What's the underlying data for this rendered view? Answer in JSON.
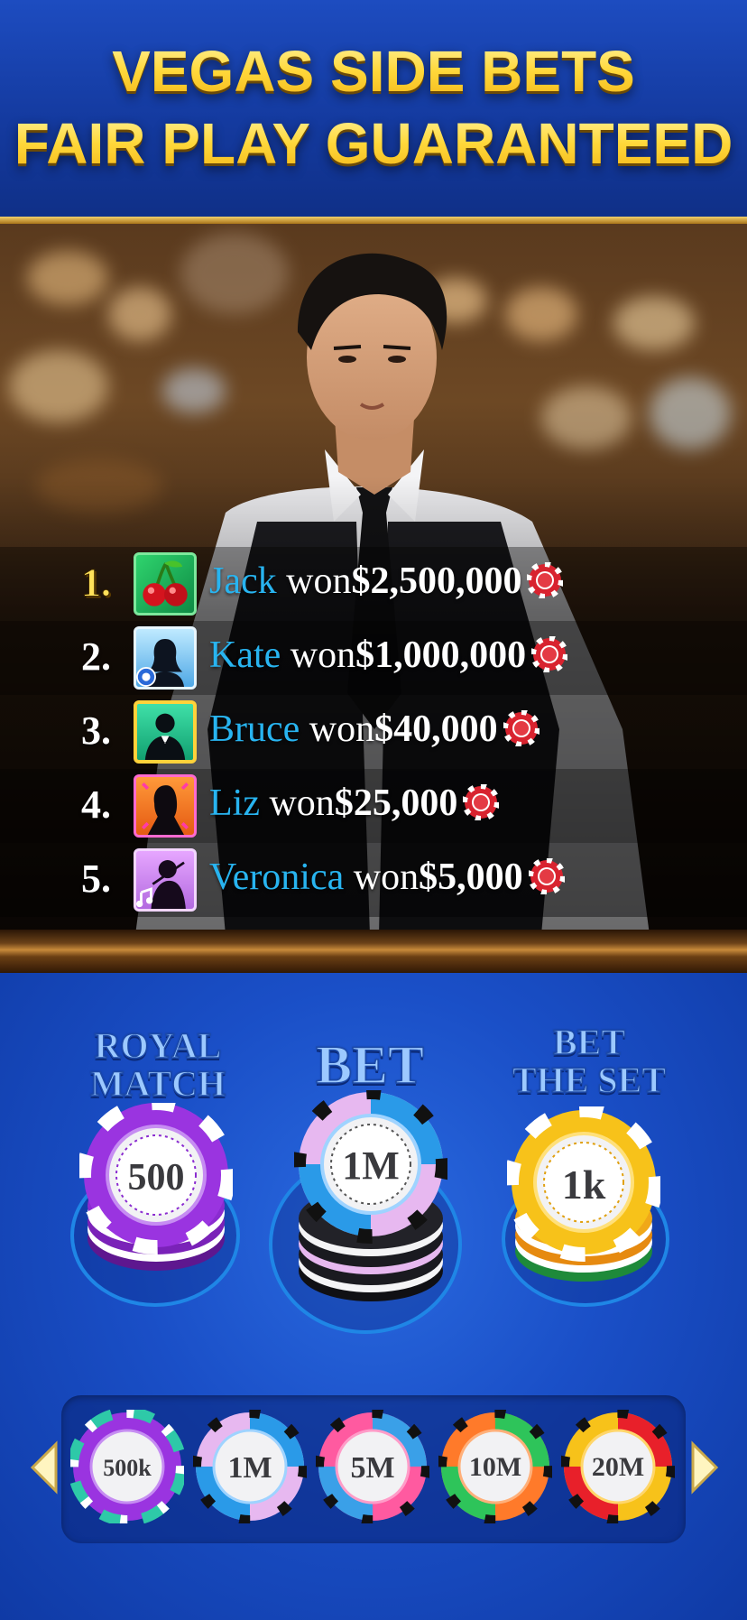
{
  "header": {
    "line1": "VEGAS SIDE BETS",
    "line2": "FAIR PLAY GUARANTEED"
  },
  "leaderboard": [
    {
      "rank": "1.",
      "name": "Jack",
      "won": "won",
      "amount": "$2,500,000",
      "avatar": "cherries-icon"
    },
    {
      "rank": "2.",
      "name": "Kate",
      "won": "won",
      "amount": "$1,000,000",
      "avatar": "woman-silhouette-icon"
    },
    {
      "rank": "3.",
      "name": "Bruce",
      "won": "won",
      "amount": "$40,000",
      "avatar": "tuxedo-man-icon"
    },
    {
      "rank": "4.",
      "name": "Liz",
      "won": "won",
      "amount": "$25,000",
      "avatar": "woman-profile-icon"
    },
    {
      "rank": "5.",
      "name": "Veronica",
      "won": "won",
      "amount": "$5,000",
      "avatar": "violinist-icon"
    }
  ],
  "bets": {
    "royal_match": {
      "line1": "ROYAL",
      "line2": "MATCH",
      "chip_value": "500"
    },
    "main": {
      "label": "BET",
      "chip_value": "1M"
    },
    "bet_the_set": {
      "line1": "BET",
      "line2": "THE SET",
      "chip_value": "1k"
    }
  },
  "chip_selector": {
    "chips": [
      "500k",
      "1M",
      "5M",
      "10M",
      "20M"
    ],
    "left_arrow": "arrow-left-icon",
    "right_arrow": "arrow-right-icon"
  },
  "colors": {
    "headline_gold": "#ffd83a",
    "player_name_blue": "#28b4f0",
    "felt_blue": "#1a4fc7",
    "chip_purple": "#8a2bd0",
    "chip_yellow": "#f7c21a"
  }
}
